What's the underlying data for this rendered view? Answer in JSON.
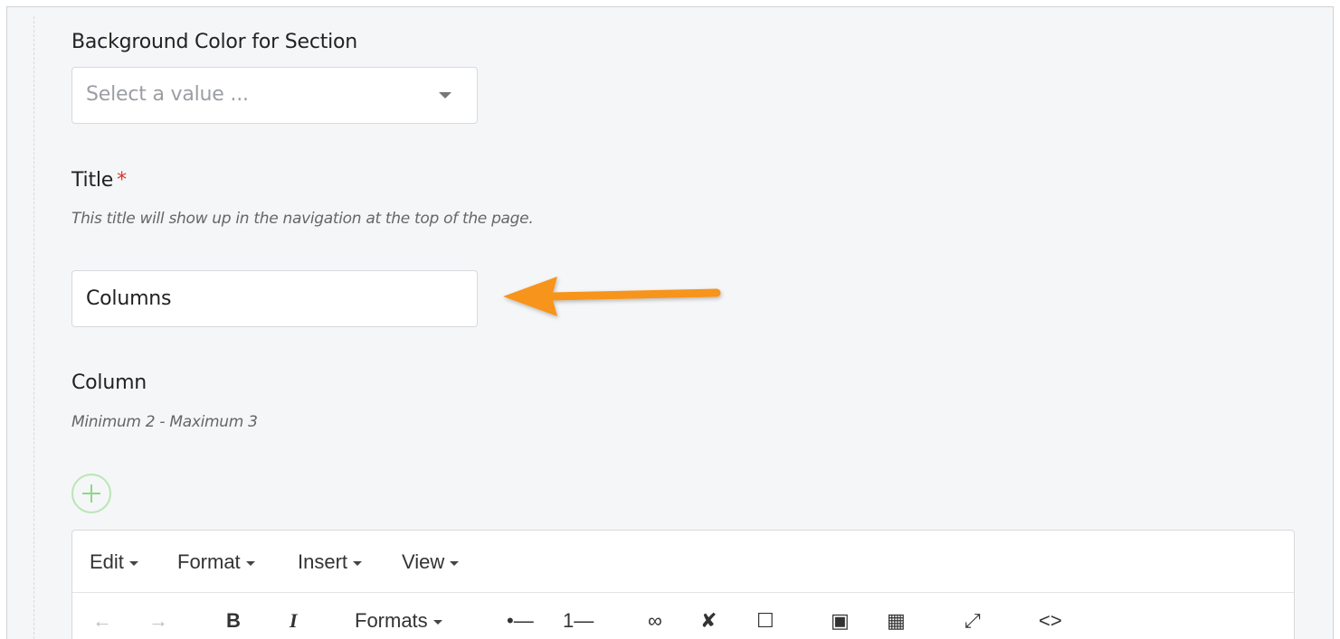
{
  "background_section": {
    "label": "Background Color for Section",
    "select_placeholder": "Select a value ..."
  },
  "title_field": {
    "label": "Title",
    "required_mark": "*",
    "help": "This title will show up in the navigation at the top of the page.",
    "value": "Columns"
  },
  "column_field": {
    "label": "Column",
    "help": "Minimum 2 - Maximum 3"
  },
  "editor": {
    "menus": [
      {
        "label": "Edit"
      },
      {
        "label": "Format"
      },
      {
        "label": "Insert"
      },
      {
        "label": "View"
      }
    ],
    "toolbar": {
      "undo_icon": "←",
      "redo_icon": "→",
      "bold": "B",
      "italic": "I",
      "formats": "Formats",
      "bullet_list_icon": "•—",
      "numbered_list_icon": "1—",
      "link_icon": "∞",
      "unlink_icon": "✘",
      "checkbox_icon": "☐",
      "image_icon": "▣",
      "media_icon": "▦",
      "fullscreen_icon": "⤢",
      "code_icon": "<>"
    }
  },
  "colors": {
    "accent_arrow": "#f7941d",
    "required": "#e0322d",
    "add_button": "#8fd78a"
  }
}
